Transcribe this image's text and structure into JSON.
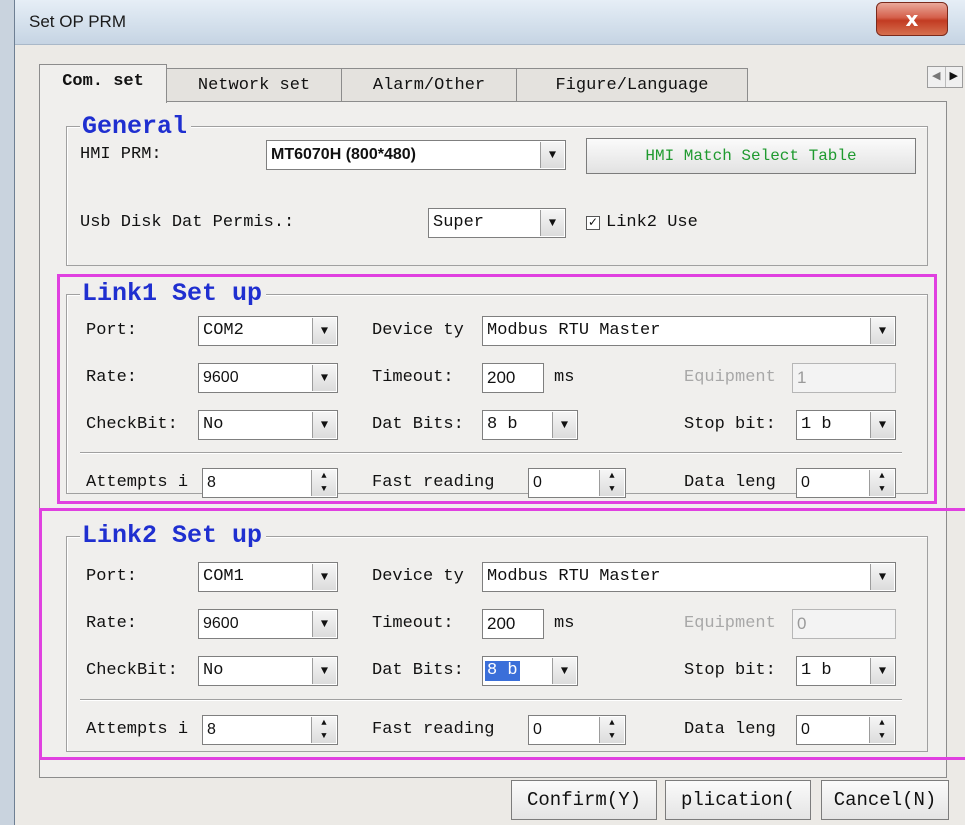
{
  "window": {
    "title": "Set OP PRM",
    "close_label": "x"
  },
  "tabs": [
    {
      "label": "Com. set"
    },
    {
      "label": "Network set"
    },
    {
      "label": "Alarm/Other"
    },
    {
      "label": "Figure/Language"
    }
  ],
  "general": {
    "title": "General",
    "hmi_prm_label": "HMI PRM:",
    "hmi_prm_value": "MT6070H (800*480)",
    "match_button": "HMI Match Select Table",
    "usb_label": "Usb Disk Dat Permis.:",
    "usb_value": "Super",
    "link2_use_label": "Link2 Use",
    "link2_use_checked": true
  },
  "link1": {
    "title": "Link1 Set up",
    "port_label": "Port:",
    "port_value": "COM2",
    "device_label": "Device ty",
    "device_value": "Modbus RTU Master",
    "rate_label": "Rate:",
    "rate_value": "9600",
    "timeout_label": "Timeout:",
    "timeout_value": "200",
    "timeout_unit": "ms",
    "equipment_label": "Equipment",
    "equipment_value": "1",
    "checkbit_label": "CheckBit:",
    "checkbit_value": "No",
    "datbits_label": "Dat Bits:",
    "datbits_value": "8 b",
    "stopbit_label": "Stop bit:",
    "stopbit_value": "1 b",
    "attempts_label": "Attempts i",
    "attempts_value": "8",
    "fast_label": "Fast reading",
    "fast_value": "0",
    "datalen_label": "Data leng",
    "datalen_value": "0"
  },
  "link2": {
    "title": "Link2 Set up",
    "port_label": "Port:",
    "port_value": "COM1",
    "device_label": "Device ty",
    "device_value": "Modbus RTU Master",
    "rate_label": "Rate:",
    "rate_value": "9600",
    "timeout_label": "Timeout:",
    "timeout_value": "200",
    "timeout_unit": "ms",
    "equipment_label": "Equipment",
    "equipment_value": "0",
    "checkbit_label": "CheckBit:",
    "checkbit_value": "No",
    "datbits_label": "Dat Bits:",
    "datbits_value": "8 b",
    "stopbit_label": "Stop bit:",
    "stopbit_value": "1 b",
    "attempts_label": "Attempts i",
    "attempts_value": "8",
    "fast_label": "Fast reading",
    "fast_value": "0",
    "datalen_label": "Data leng",
    "datalen_value": "0"
  },
  "footer": {
    "confirm_label": "Confirm(Y)",
    "application_label": "plication(",
    "cancel_label": "Cancel(N)"
  },
  "colors": {
    "group_title": "#1f2fd0",
    "highlight": "#e040e0",
    "match_button_text": "#1f9a2f"
  },
  "icons": {
    "dropdown": "chevron-down-icon",
    "spin": "spin-arrows-icon",
    "close": "close-icon",
    "tab_scroll": "arrow-left-right-icon"
  }
}
